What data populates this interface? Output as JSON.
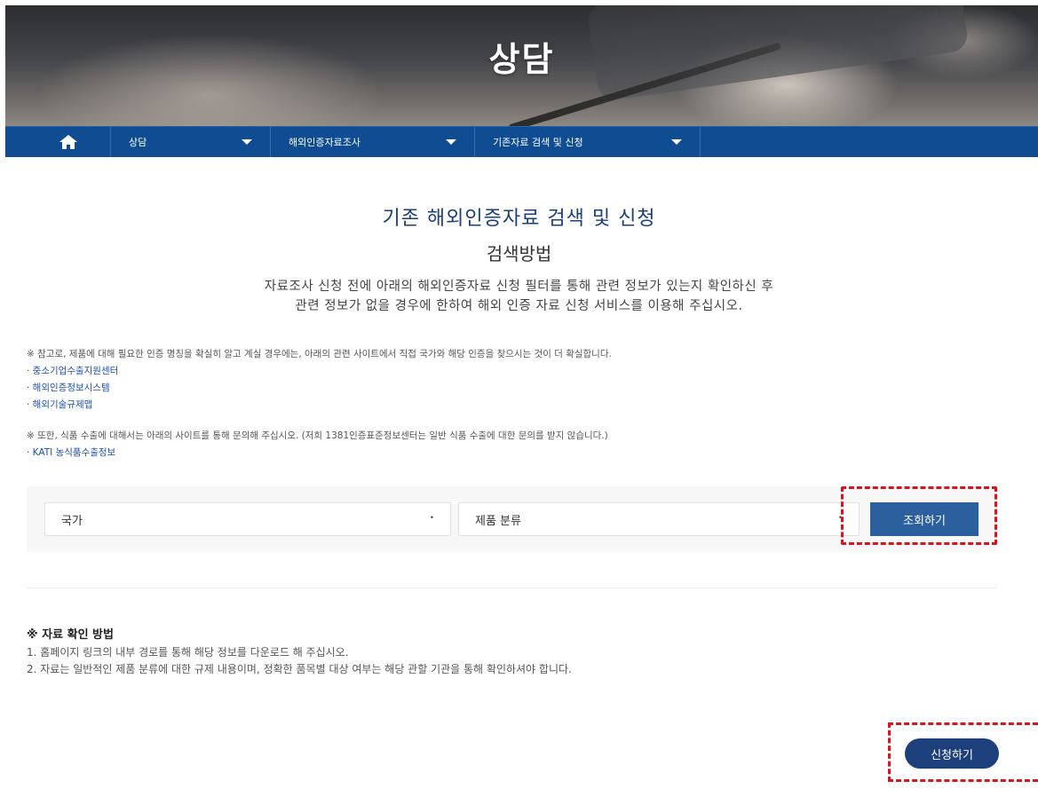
{
  "hero": {
    "title": "상담"
  },
  "nav": {
    "home_icon": "home-icon",
    "items": [
      {
        "label": "상담"
      },
      {
        "label": "해외인증자료조사"
      },
      {
        "label": "기존자료 검색 및 신청"
      }
    ]
  },
  "main": {
    "title": "기존 해외인증자료 검색 및 신청",
    "subtitle": "검색방법",
    "desc_line1": "자료조사 신청 전에 아래의 해외인증자료 신청 필터를 통해 관련 정보가 있는지 확인하신 후",
    "desc_line2": "관련 정보가 없을 경우에 한하여 해외 인증 자료 신청 서비스를 이용해 주십시오."
  },
  "notes": {
    "note1": "※ 참고로, 제품에 대해 필요한 인증 명칭을 확실히 알고 계실 경우에는, 아래의 관련 사이트에서 직접 국가와 해당 인증을 찾으시는 것이 더 확실합니다.",
    "links1": [
      "· 중소기업수출지원센터",
      "· 해외인증정보시스템",
      "· 해외기술규제맵"
    ],
    "note2": "※ 또한, 식품 수출에 대해서는 아래의 사이트를 통해 문의해 주십시오. (저희 1381인증표준정보센터는 일반 식품 수출에 대한 문의를 받지 않습니다.)",
    "links2": [
      "· KATI 농식품수출정보"
    ]
  },
  "search": {
    "country_label": "국가",
    "product_label": "제품 분류",
    "dropdown_marker": "•",
    "button": "조회하기"
  },
  "howto": {
    "heading": "※ 자료 확인 방법",
    "line1": "1. 홈페이지 링크의 내부 경로를 통해 해당 정보를 다운로드 해 주십시오.",
    "line2": "2. 자료는 일반적인 제품 분류에 대한 규제 내용이며, 정확한 품목별 대상 여부는 해당 관할 기관을 통해 확인하셔야 합니다."
  },
  "apply": {
    "button": "신청하기"
  },
  "colors": {
    "nav_bg": "#0f4c92",
    "button_bg": "#2c5f9e",
    "apply_bg": "#1d3f7c",
    "highlight": "#d9141c",
    "link": "#1f4fb0"
  }
}
